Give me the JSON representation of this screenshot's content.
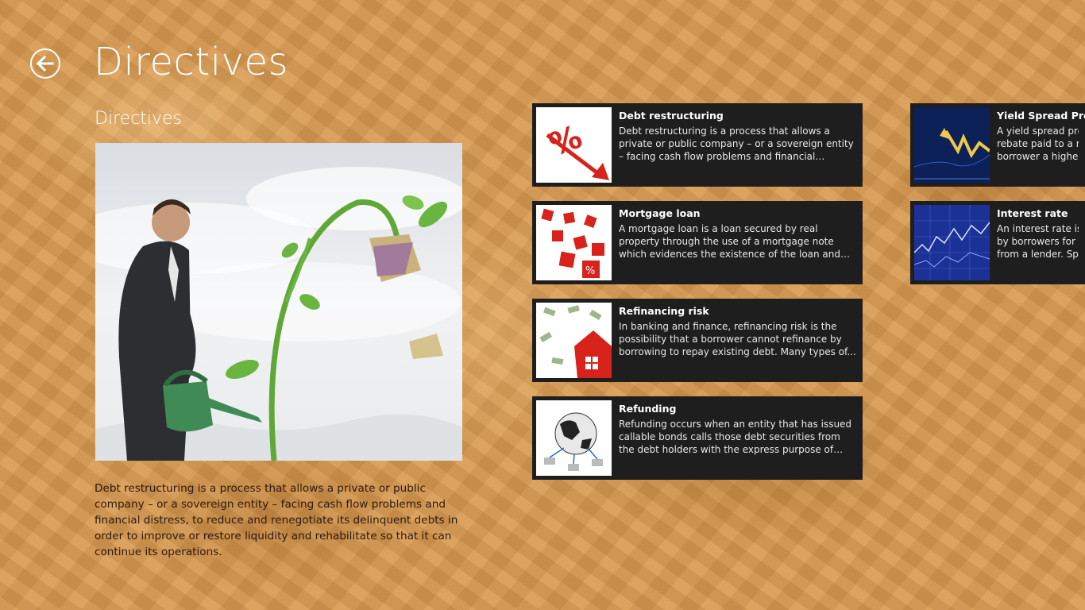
{
  "header": {
    "title": "Directives",
    "back_icon": "back-arrow-icon"
  },
  "section": {
    "title": "Directives",
    "description": "Debt restructuring is a process that allows a private or public company – or a sovereign entity – facing cash flow problems and financial distress, to reduce and renegotiate its delinquent debts in order to improve or restore liquidity and rehabilitate so that it can continue its operations."
  },
  "items": [
    {
      "title": "Debt restructuring",
      "description": "Debt restructuring is a process that allows a private or public company – or a sovereign entity – facing cash flow problems and financial distress, to..."
    },
    {
      "title": "Mortgage loan",
      "description": "A mortgage loan is a loan secured by real property through the use of a mortgage note which evidences the existence of the loan and the..."
    },
    {
      "title": "Refinancing risk",
      "description": "In banking and finance, refinancing risk is the possibility that a borrower cannot refinance by borrowing to repay existing debt. Many types of..."
    },
    {
      "title": "Refunding",
      "description": "Refunding occurs when an entity that has issued callable bonds calls those debt securities from the debt holders with the express purpose of reissuing..."
    },
    {
      "title": "Yield Spread Prem",
      "description_lines": [
        "A yield spread prem",
        "rebate paid to a mo",
        "borrower a higher i"
      ]
    },
    {
      "title": "Interest rate",
      "description_lines": [
        "An interest rate is th",
        "by borrowers for th",
        "from a lender. Spec"
      ]
    }
  ],
  "colors": {
    "background": "#d99a50",
    "tile": "#1e1e1e",
    "accent_red": "#d8231c"
  }
}
